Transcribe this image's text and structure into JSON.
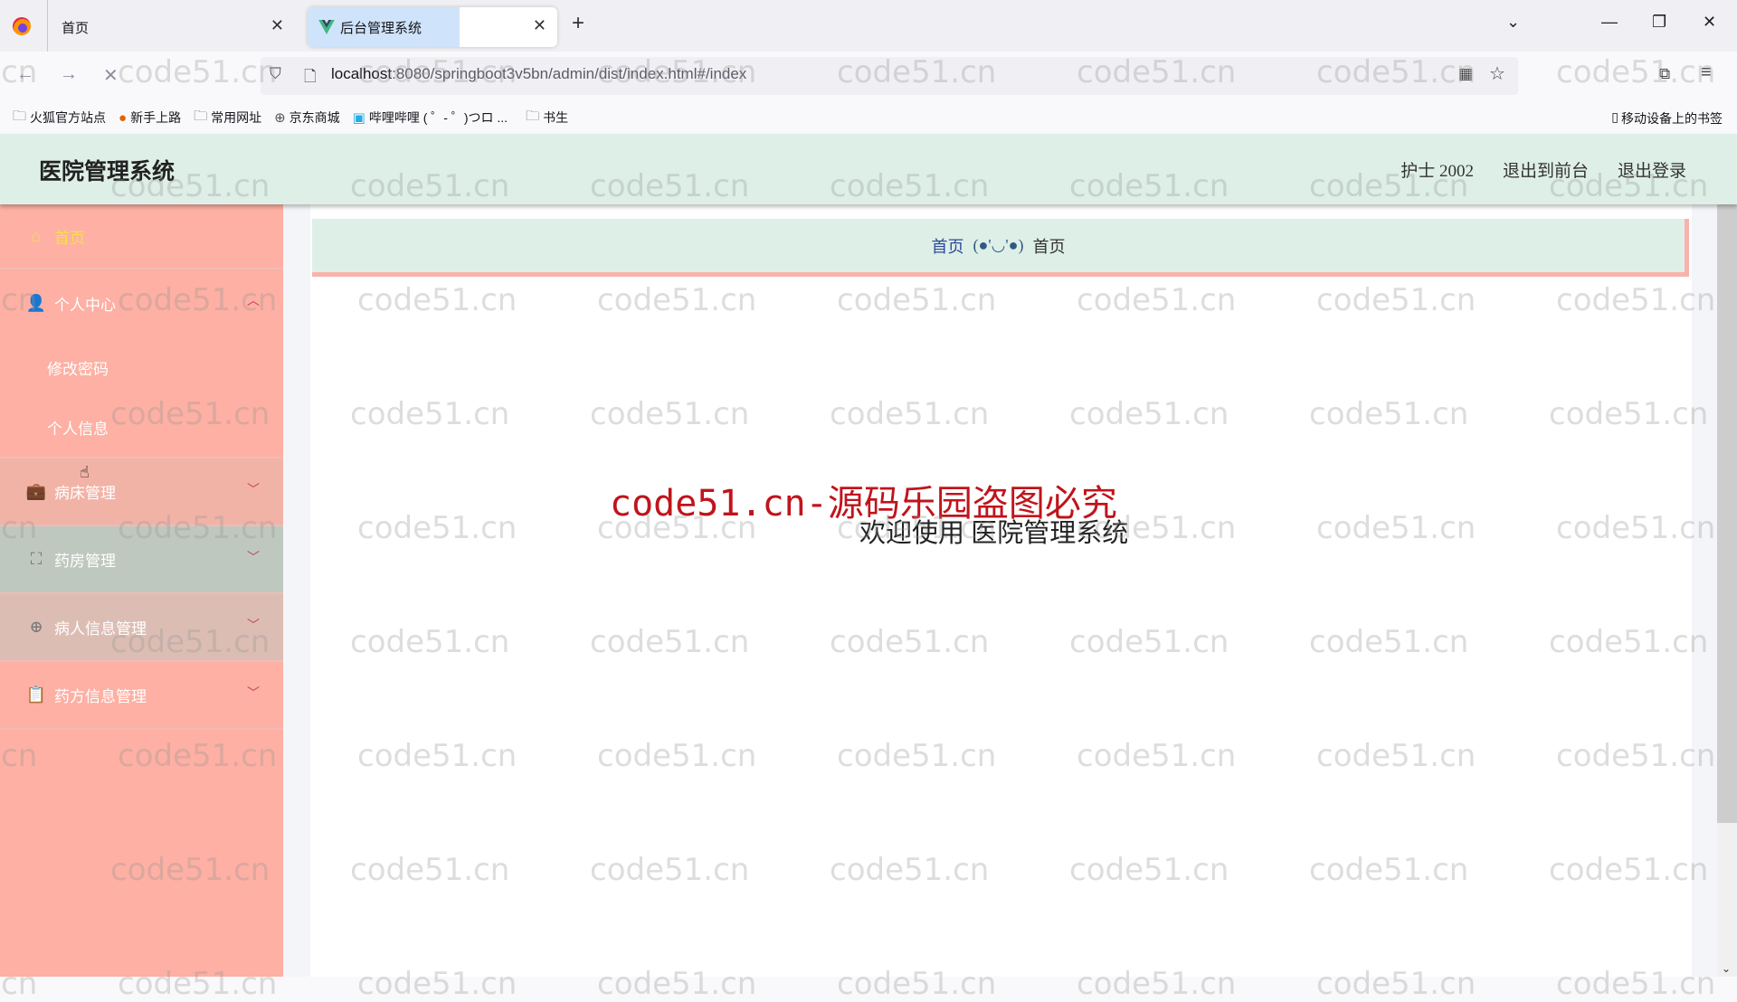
{
  "browser": {
    "tabs": [
      {
        "label": "首页",
        "active": false
      },
      {
        "label": "后台管理系统",
        "active": true
      }
    ],
    "url_host": "localhost",
    "url_rest": ":8080/springboot3v5bn/admin/dist/index.html#/index",
    "bookmarks": [
      {
        "icon": "folder-icon",
        "label": "火狐官方站点"
      },
      {
        "icon": "firefox-icon",
        "label": "新手上路"
      },
      {
        "icon": "folder-icon",
        "label": "常用网址"
      },
      {
        "icon": "globe-icon",
        "label": "京东商城"
      },
      {
        "icon": "bilibili-icon",
        "label": "哔哩哔哩 ( ゜- ゜)つロ ..."
      },
      {
        "icon": "folder-icon",
        "label": "书生"
      }
    ],
    "mobile_bookmarks": "移动设备上的书签"
  },
  "header": {
    "title": "医院管理系统",
    "user": "护士 2002",
    "to_front": "退出到前台",
    "logout": "退出登录"
  },
  "sidebar": {
    "home": "首页",
    "personal_center": "个人中心",
    "personal_sub": [
      "修改密码",
      "个人信息"
    ],
    "groups": [
      {
        "label": "病床管理",
        "icon": "briefcase-icon"
      },
      {
        "label": "药房管理",
        "icon": "scan-icon"
      },
      {
        "label": "病人信息管理",
        "icon": "target-icon"
      },
      {
        "label": "药方信息管理",
        "icon": "clipboard-icon"
      }
    ]
  },
  "breadcrumb": {
    "link": "首页",
    "separator": "(●'◡'●)",
    "current": "首页"
  },
  "main": {
    "welcome": "欢迎使用 医院管理系统"
  },
  "overlay": {
    "banner": "code51.cn-源码乐园盗图必究",
    "watermark": "code51.cn"
  },
  "colors": {
    "header_bg": "#deefe7",
    "sidebar_bg": "#fdb0a3",
    "home_active": "#f7e04a",
    "banner_red": "#c0141c"
  }
}
